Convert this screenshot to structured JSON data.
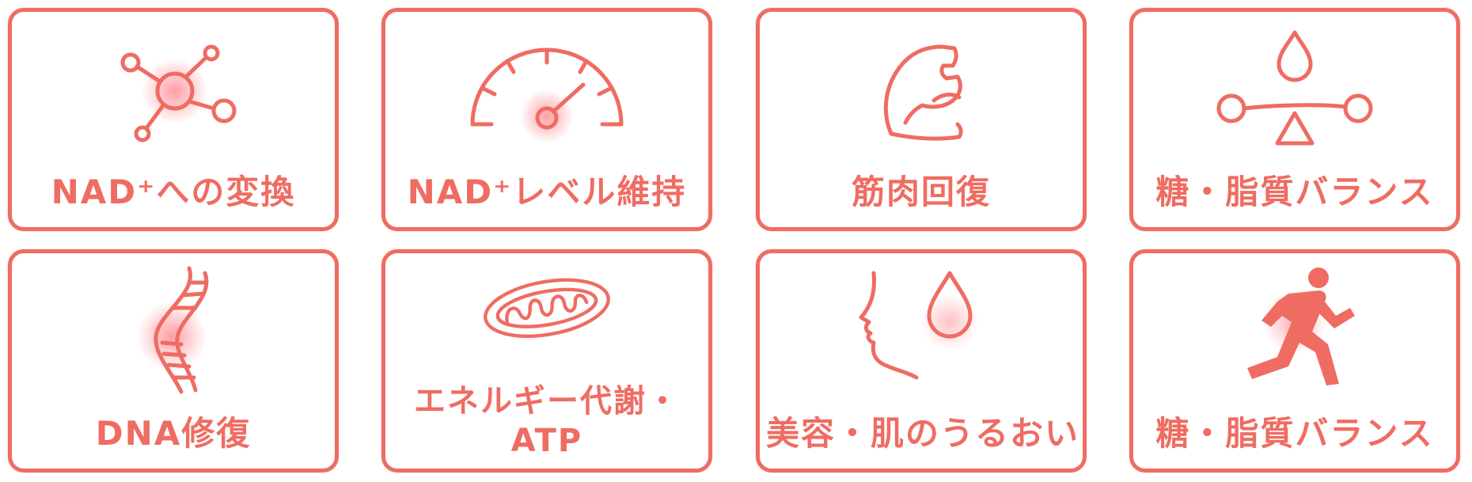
{
  "accent_color": "#ef6c62",
  "cards": [
    {
      "label": "NAD⁺への変換",
      "icon": "molecule-icon"
    },
    {
      "label": "NAD⁺レベル維持",
      "icon": "gauge-icon"
    },
    {
      "label": "筋肉回復",
      "icon": "muscle-arm-icon"
    },
    {
      "label": "糖・脂質バランス",
      "icon": "balance-scale-icon"
    },
    {
      "label": "DNA修復",
      "icon": "dna-helix-icon"
    },
    {
      "label_line1": "エネルギー代謝・",
      "label_line2": "ATP",
      "icon": "mitochondria-icon"
    },
    {
      "label": "美容・肌のうるおい",
      "icon": "face-droplet-icon"
    },
    {
      "label": "糖・脂質バランス",
      "icon": "running-person-icon"
    }
  ]
}
